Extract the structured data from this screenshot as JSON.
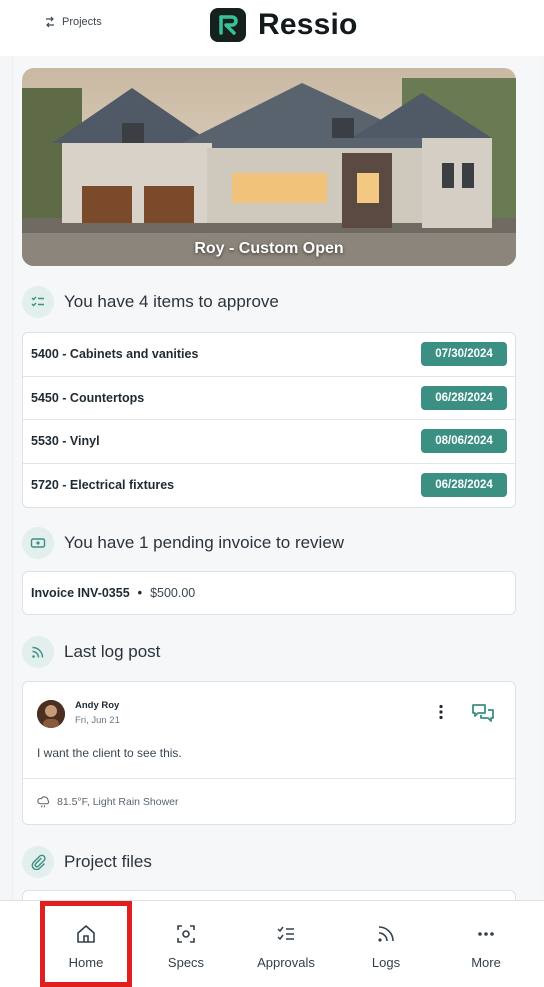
{
  "header": {
    "projects_label": "Projects",
    "brand_name": "Ressio",
    "brand_color": "#16211e"
  },
  "hero": {
    "title": "Roy - Custom Open"
  },
  "approvals": {
    "heading": "You have 4 items to approve",
    "icon": "checklist-icon",
    "items": [
      {
        "label": "5400 - Cabinets and vanities",
        "date": "07/30/2024"
      },
      {
        "label": "5450 - Countertops",
        "date": "06/28/2024"
      },
      {
        "label": "5530 - Vinyl",
        "date": "08/06/2024"
      },
      {
        "label": "5720 - Electrical fixtures",
        "date": "06/28/2024"
      }
    ],
    "badge_color": "#3b8f83"
  },
  "invoices": {
    "heading": "You have 1 pending invoice to review",
    "icon": "invoice-icon",
    "items": [
      {
        "name": "Invoice INV-0355",
        "separator": "•",
        "amount": "$500.00"
      }
    ]
  },
  "log": {
    "heading": "Last log post",
    "icon": "rss-icon",
    "post": {
      "author": "Andy Roy",
      "date": "Fri, Jun 21",
      "text": "I want the client to see this.",
      "weather": "81.5°F, Light Rain Shower"
    }
  },
  "files": {
    "heading": "Project files",
    "icon": "paperclip-icon"
  },
  "bottom_nav": {
    "items": [
      {
        "label": "Home",
        "icon": "home-icon"
      },
      {
        "label": "Specs",
        "icon": "specs-icon"
      },
      {
        "label": "Approvals",
        "icon": "checklist-icon"
      },
      {
        "label": "Logs",
        "icon": "rss-icon"
      },
      {
        "label": "More",
        "icon": "more-icon"
      }
    ],
    "active": "Home",
    "highlight_color": "#e02020"
  }
}
